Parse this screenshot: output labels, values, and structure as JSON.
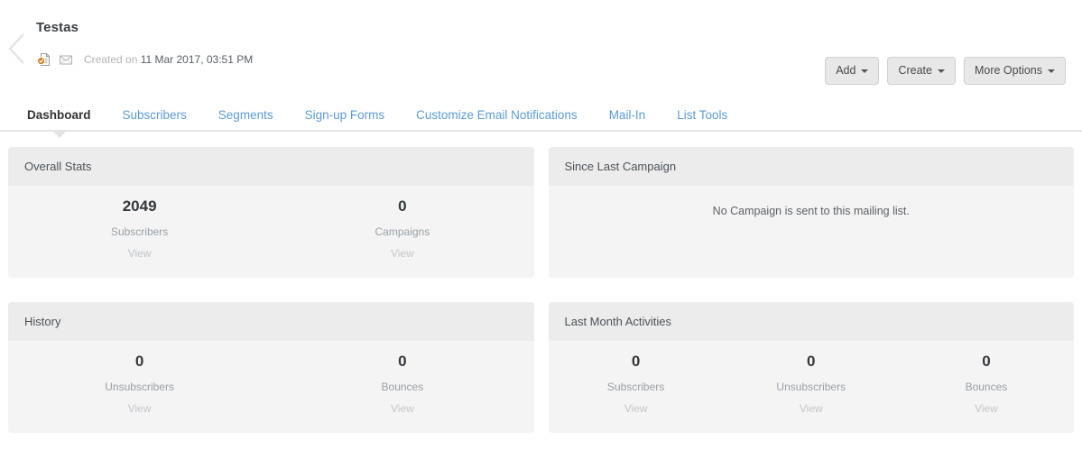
{
  "header": {
    "back_icon": "chevron-left-icon",
    "title": "Testas",
    "doc_icon": "document-verified-icon",
    "envelope_icon": "envelope-icon",
    "created_prefix": "Created on",
    "created_date": "11 Mar 2017, 03:51 PM",
    "buttons": [
      {
        "label": "Add",
        "icon": "caret-down-icon"
      },
      {
        "label": "Create",
        "icon": "caret-down-icon"
      },
      {
        "label": "More Options",
        "icon": "caret-down-icon"
      }
    ]
  },
  "tabs": [
    {
      "label": "Dashboard",
      "active": true
    },
    {
      "label": "Subscribers",
      "active": false
    },
    {
      "label": "Segments",
      "active": false
    },
    {
      "label": "Sign-up Forms",
      "active": false
    },
    {
      "label": "Customize Email Notifications",
      "active": false
    },
    {
      "label": "Mail-In",
      "active": false
    },
    {
      "label": "List Tools",
      "active": false
    }
  ],
  "panels": {
    "overall_stats": {
      "title": "Overall Stats",
      "stats": [
        {
          "value": "2049",
          "label": "Subscribers",
          "link": "View"
        },
        {
          "value": "0",
          "label": "Campaigns",
          "link": "View"
        }
      ]
    },
    "since_last_campaign": {
      "title": "Since Last Campaign",
      "message": "No Campaign is sent to this mailing list."
    },
    "history": {
      "title": "History",
      "stats": [
        {
          "value": "0",
          "label": "Unsubscribers",
          "link": "View"
        },
        {
          "value": "0",
          "label": "Bounces",
          "link": "View"
        }
      ]
    },
    "last_month_activities": {
      "title": "Last Month Activities",
      "stats": [
        {
          "value": "0",
          "label": "Subscribers",
          "link": "View"
        },
        {
          "value": "0",
          "label": "Unsubscribers",
          "link": "View"
        },
        {
          "value": "0",
          "label": "Bounces",
          "link": "View"
        }
      ]
    }
  },
  "colors": {
    "tab_link": "#5b9bd5",
    "panel_head_bg": "#ececec",
    "panel_body_bg": "#f4f4f4",
    "button_bg": "#e8e8e8",
    "doc_badge": "#d4791f"
  }
}
